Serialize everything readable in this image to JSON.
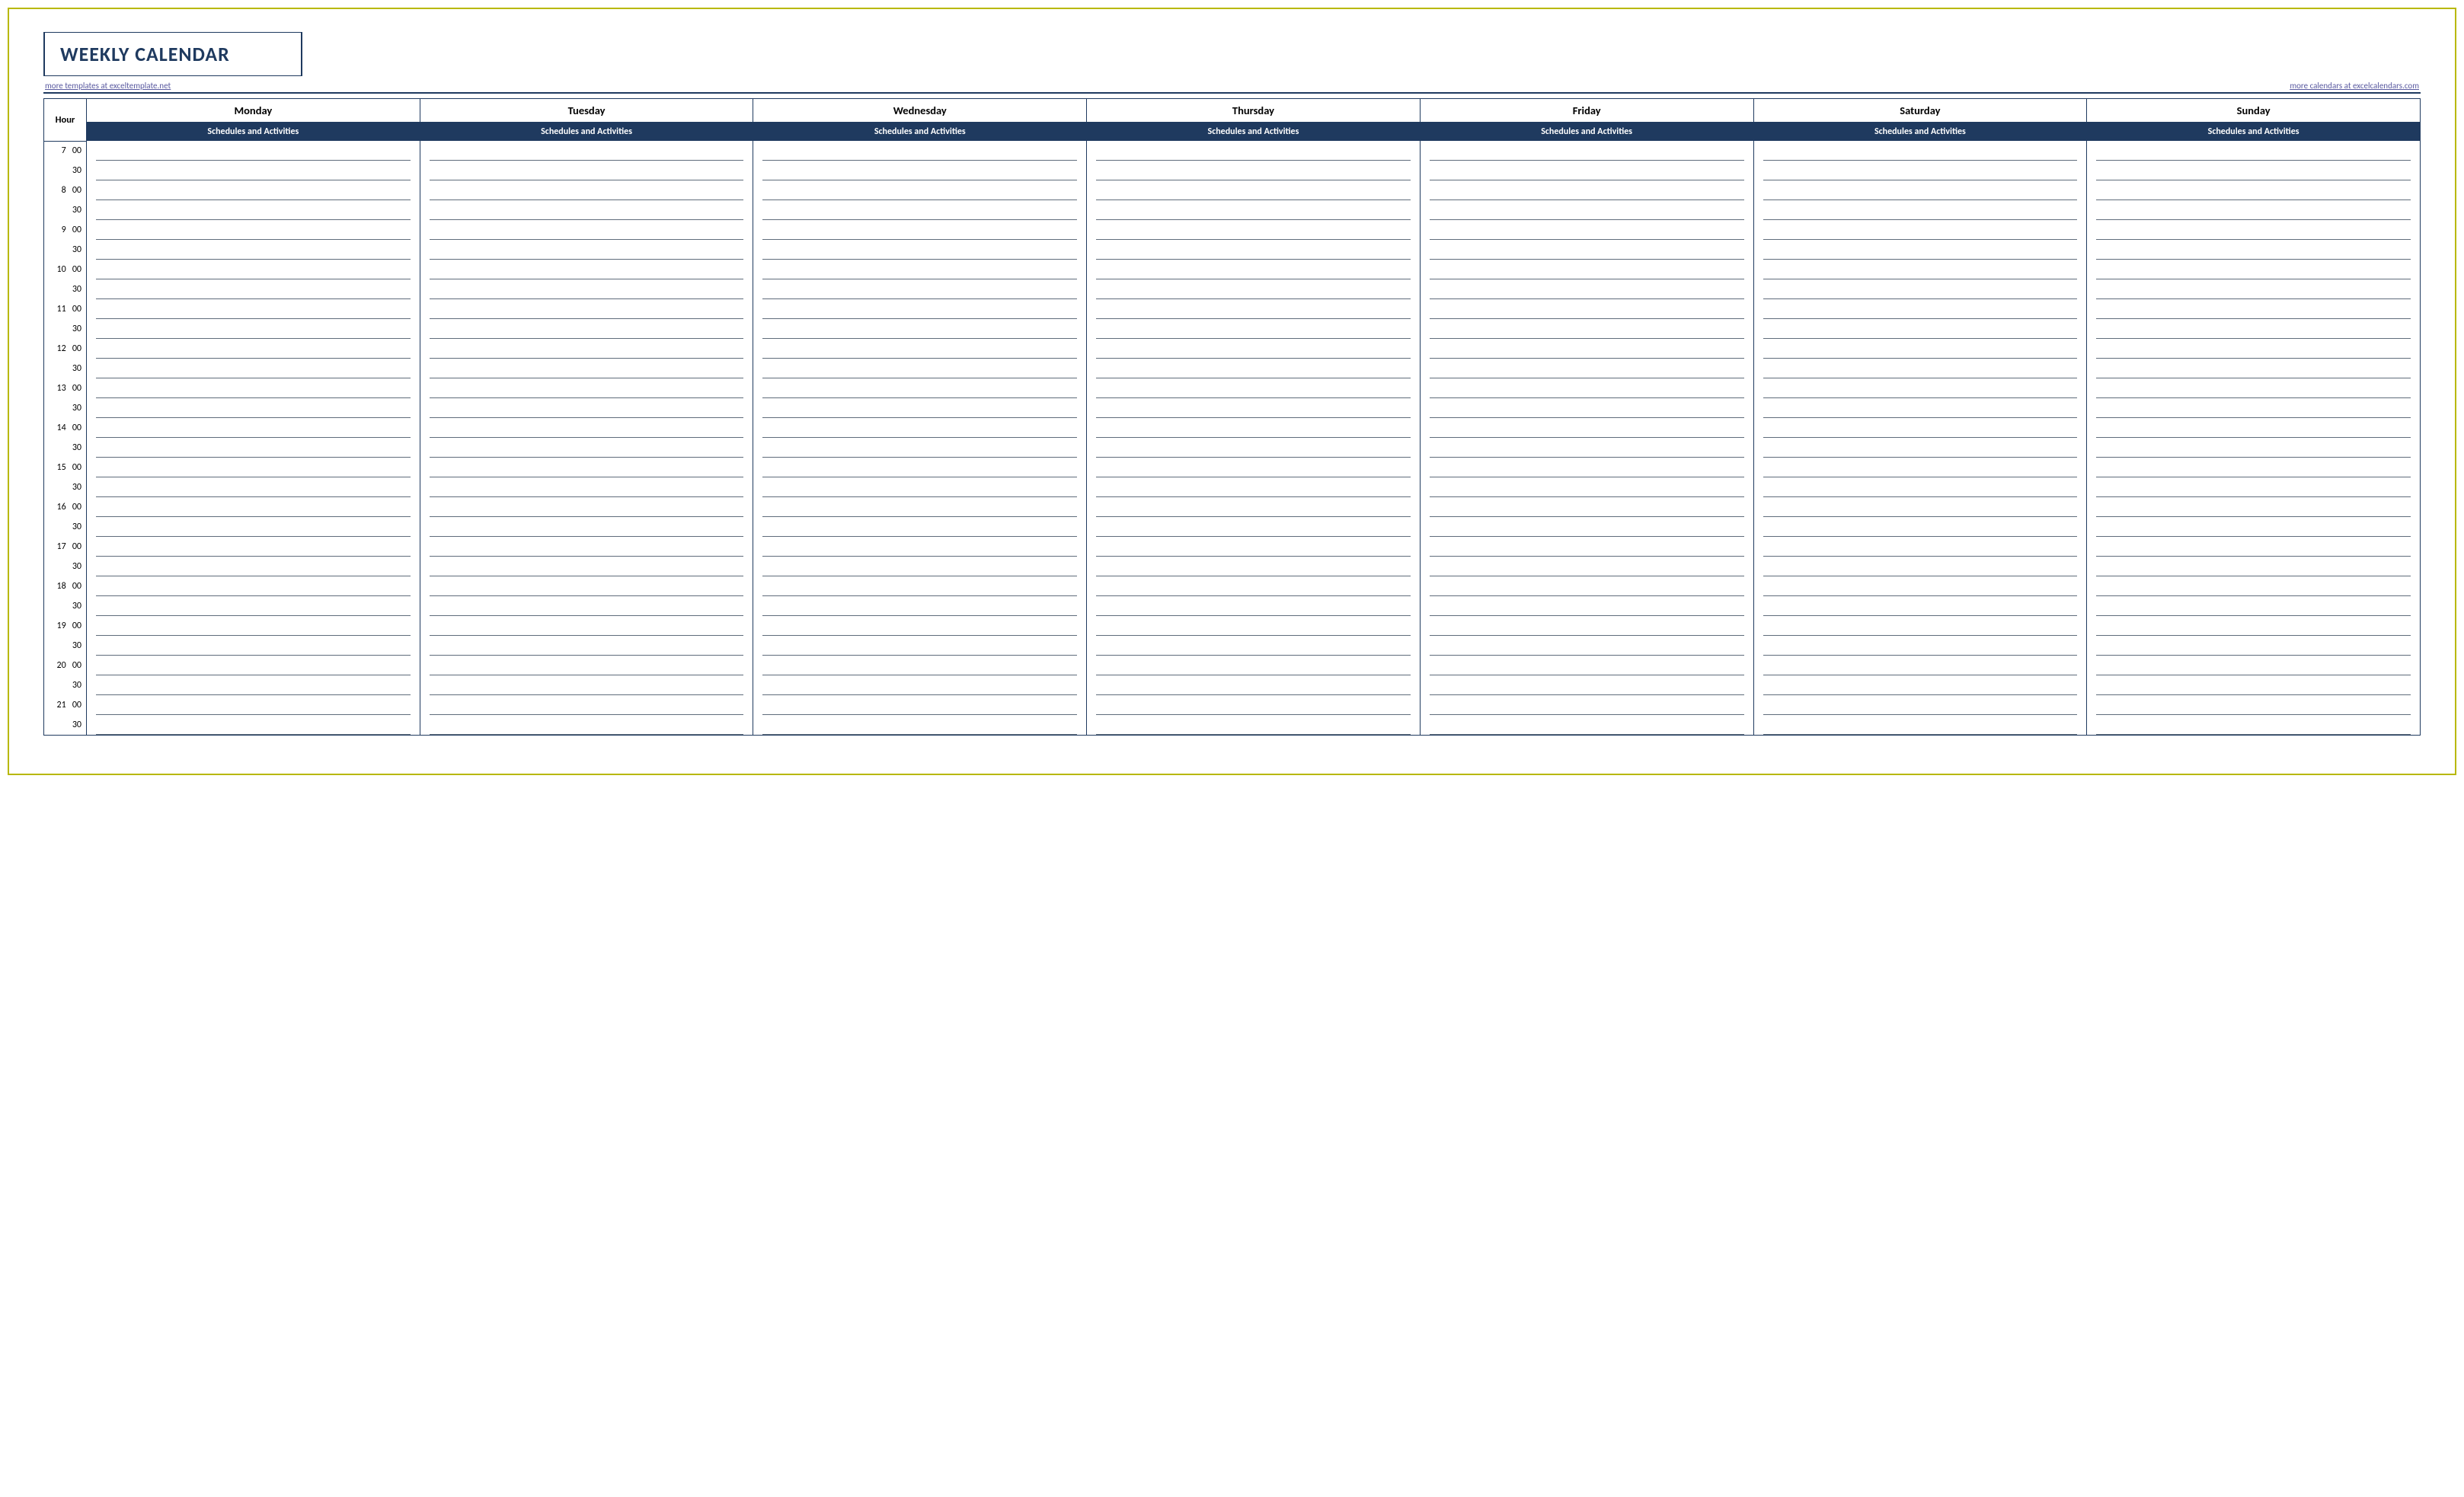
{
  "title": "WEEKLY CALENDAR",
  "link_left": "more templates at exceltemplate.net",
  "link_right": "more calendars at excelcalendars.com",
  "hour_label": "Hour",
  "sub_header": "Schedules and Activities",
  "days": [
    "Monday",
    "Tuesday",
    "Wednesday",
    "Thursday",
    "Friday",
    "Saturday",
    "Sunday"
  ],
  "hours": [
    7,
    8,
    9,
    10,
    11,
    12,
    13,
    14,
    15,
    16,
    17,
    18,
    19,
    20,
    21
  ],
  "minute_top": "00",
  "minute_bottom": "30"
}
